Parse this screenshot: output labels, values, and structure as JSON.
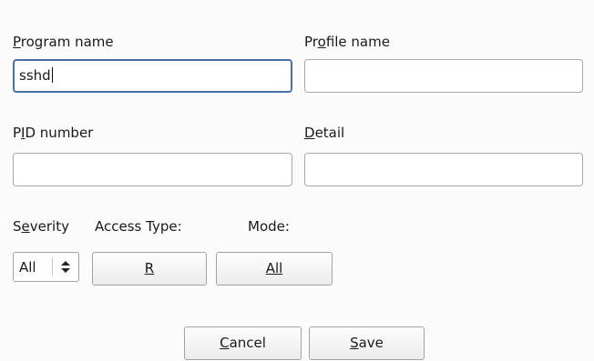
{
  "program": {
    "label_u": "P",
    "label_rest": "rogram name",
    "value": "sshd"
  },
  "profile": {
    "label_a": "Pr",
    "label_u": "o",
    "label_b": "file name",
    "value": ""
  },
  "pid": {
    "label_a": "P",
    "label_u": "I",
    "label_b": "D number",
    "value": ""
  },
  "detail": {
    "label_u": "D",
    "label_rest": "etail",
    "value": ""
  },
  "severity": {
    "label_a": "S",
    "label_u": "e",
    "label_b": "verity",
    "value": "All"
  },
  "access_type": {
    "label": "Access Type:",
    "value": "R"
  },
  "mode": {
    "label": "Mode:",
    "value": "All"
  },
  "cancel": {
    "label_u": "C",
    "label_rest": "ancel"
  },
  "save": {
    "label_u": "S",
    "label_rest": "ave"
  }
}
